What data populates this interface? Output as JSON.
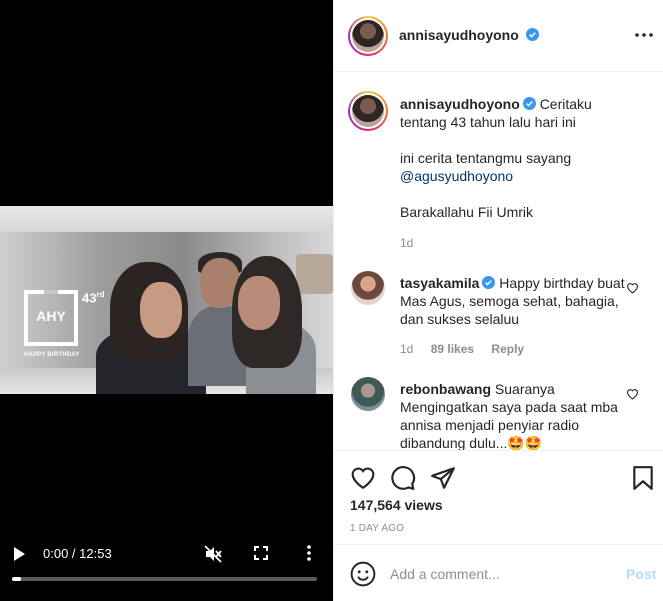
{
  "video": {
    "overlay_logo": "AHY",
    "overlay_number": "43",
    "overlay_number_suffix": "rd",
    "overlay_caption": "HAPPY BIRTHDAY",
    "time": "0:00 / 12:53",
    "progress": 0.03
  },
  "header": {
    "username": "annisayudhoyono",
    "verified": true
  },
  "caption": {
    "username": "annisayudhoyono",
    "text_1": "Ceritaku tentang 43 tahun lalu hari ini",
    "text_2": "ini cerita tentangmu sayang",
    "mention": "@agusyudhoyono",
    "text_3": "Barakallahu Fii Umrik",
    "age": "1d"
  },
  "comments": [
    {
      "username": "tasyakamila",
      "verified": true,
      "text": "Happy birthday buat Mas Agus, semoga sehat, bahagia, dan sukses selaluu",
      "age": "1d",
      "likes": "89 likes",
      "reply": "Reply"
    },
    {
      "username": "rebonbawang",
      "verified": false,
      "text": "Suaranya Mengingatkan saya pada saat mba annisa menjadi penyiar radio dibandung dulu...🤩🤩"
    }
  ],
  "stats": {
    "views": "147,564 views",
    "posted": "1 DAY AGO"
  },
  "add_comment": {
    "placeholder": "Add a comment...",
    "post_label": "Post"
  },
  "colors": {
    "verified": "#3897f0",
    "link": "#00376b",
    "muted": "#8e8e8e",
    "post_disabled": "#b2dffc"
  }
}
